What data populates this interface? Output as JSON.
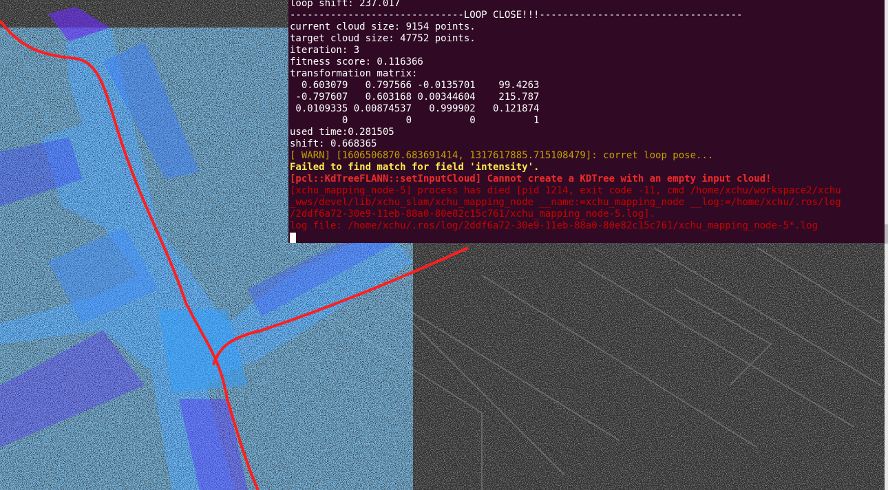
{
  "terminal": {
    "lines": [
      {
        "text": "loop shift: 237.017",
        "style": "normal"
      },
      {
        "text": "------------------------------LOOP CLOSE!!!-----------------------------------",
        "style": "normal"
      },
      {
        "text": "current cloud size: 9154 points.",
        "style": "normal"
      },
      {
        "text": "target cloud size: 47752 points.",
        "style": "normal"
      },
      {
        "text": "iteration: 3",
        "style": "normal"
      },
      {
        "text": "fitness score: 0.116366",
        "style": "normal"
      },
      {
        "text": "transformation matrix:",
        "style": "normal"
      },
      {
        "text": "  0.603079   0.797566 -0.0135701    99.4263",
        "style": "normal"
      },
      {
        "text": " -0.797607   0.603168 0.00344604    215.787",
        "style": "normal"
      },
      {
        "text": " 0.0109335 0.00874537   0.999902   0.121874",
        "style": "normal"
      },
      {
        "text": "         0          0          0          1",
        "style": "normal"
      },
      {
        "text": "used time:0.281505",
        "style": "normal"
      },
      {
        "text": "shift: 0.668365",
        "style": "normal"
      },
      {
        "text": "[ WARN] [1606506870.683691414, 1317617885.715108479]: corret loop pose...",
        "style": "warn"
      },
      {
        "text": "Failed to find match for field 'intensity'.",
        "style": "fail"
      },
      {
        "text": "[pcl::KdTreeFLANN::setInputCloud] Cannot create a KDTree with an empty input cloud!",
        "style": "err-bold"
      },
      {
        "text": "[xchu_mapping_node-5] process has died [pid 1214, exit code -11, cmd /home/xchu/workspace2/xchu",
        "style": "err"
      },
      {
        "text": "_wws/devel/lib/xchu_slam/xchu_mapping_node __name:=xchu_mapping_node __log:=/home/xchu/.ros/log",
        "style": "err"
      },
      {
        "text": "/2ddf6a72-30e9-11eb-88a0-80e82c15c761/xchu_mapping_node-5.log].",
        "style": "err"
      },
      {
        "text": "log file: /home/xchu/.ros/log/2ddf6a72-30e9-11eb-88a0-80e82c15c761/xchu_mapping_node-5*.log",
        "style": "err"
      }
    ]
  },
  "colors": {
    "terminal_bg": "#300a24",
    "viewport_bg": "#303030",
    "trajectory": "#ff1f1f",
    "cloud_primary": "#2b8fff",
    "cloud_secondary": "#6a2cff",
    "warn": "#c4a000",
    "error": "#cc0000",
    "error_bold": "#ef2929"
  }
}
